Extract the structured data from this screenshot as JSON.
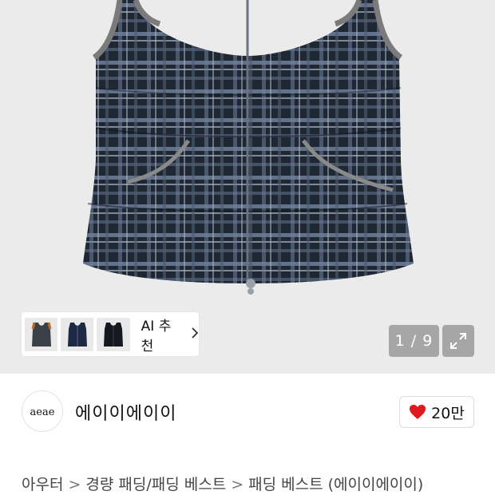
{
  "gallery": {
    "counter": "1 / 9",
    "ai_recommend_label": "AI 추천",
    "thumbnails": [
      "vest-orange-thumb",
      "vest-navy-thumb",
      "vest-black-thumb"
    ]
  },
  "brand": {
    "logo_text": "aeae",
    "name": "에이이에이이"
  },
  "like": {
    "count": "20만",
    "heart_color": "#e0191f"
  },
  "breadcrumb": {
    "items": [
      "아우터",
      "경량 패딩/패딩 베스트",
      "패딩 베스트 (에이이에이이)"
    ]
  }
}
